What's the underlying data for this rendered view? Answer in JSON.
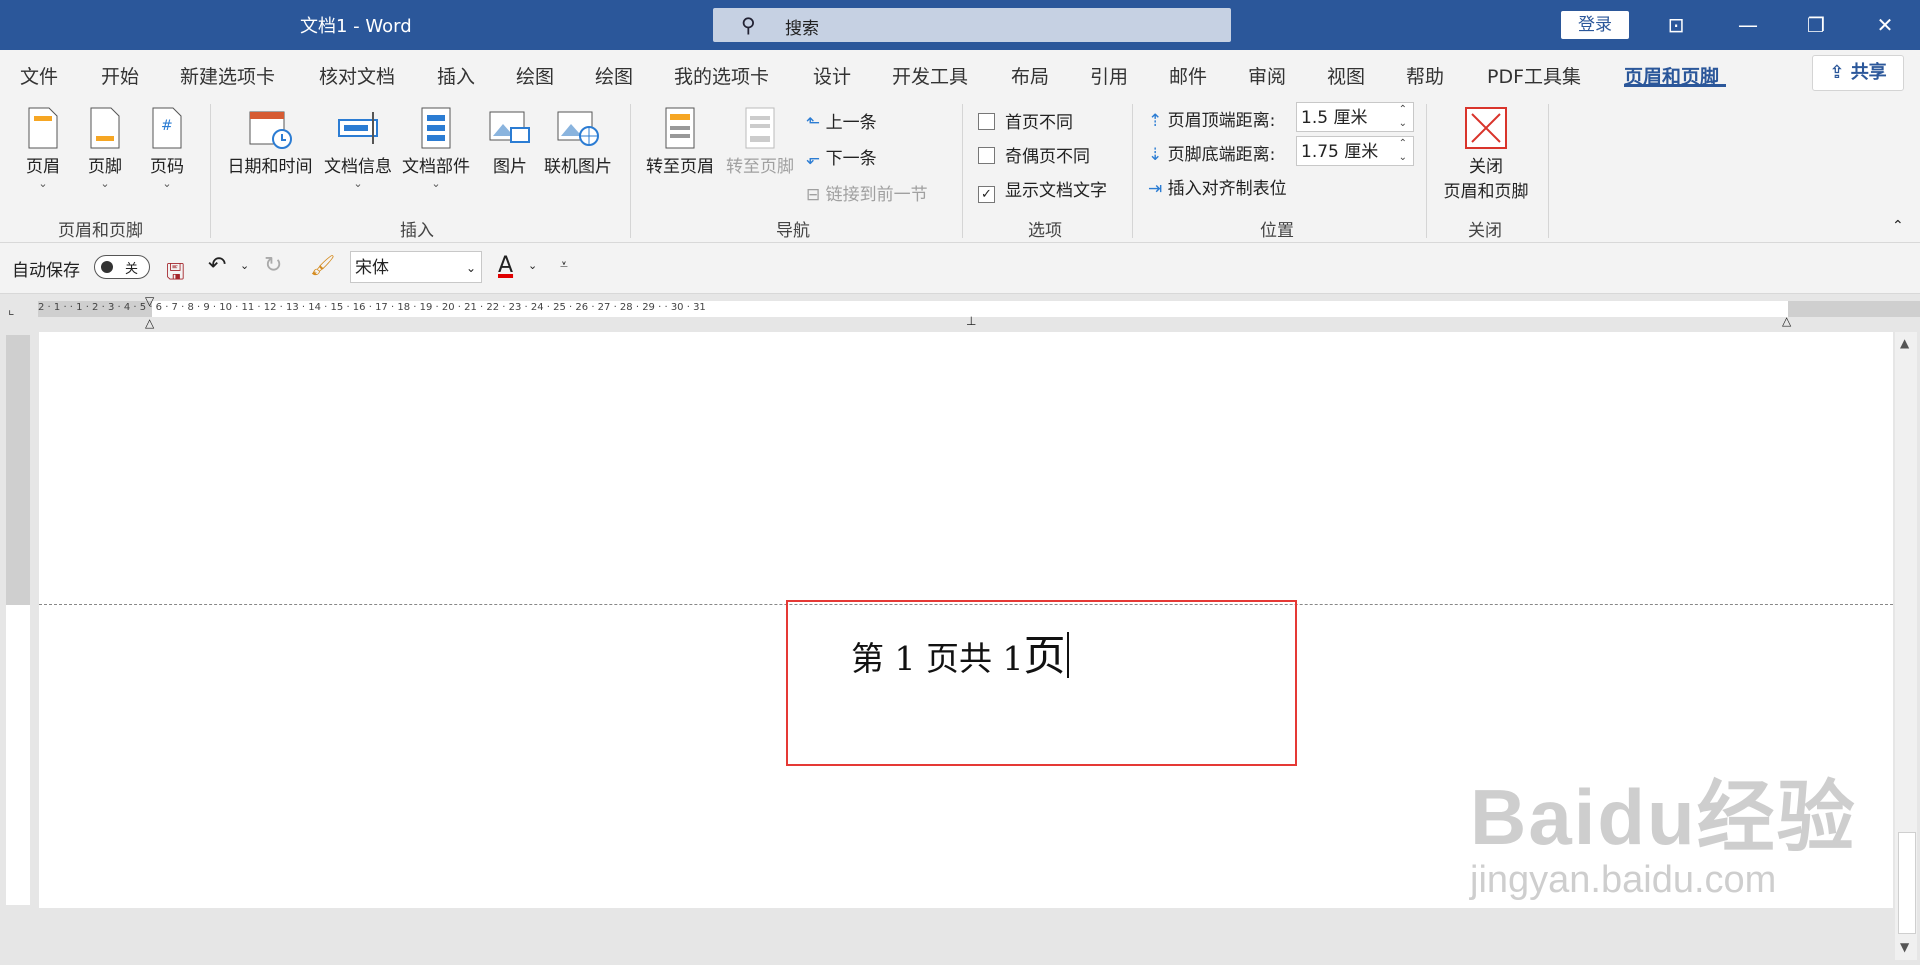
{
  "app": {
    "title": "文档1 - Word",
    "search_placeholder": "搜索",
    "login": "登录"
  },
  "menu": {
    "tabs": [
      "文件",
      "开始",
      "新建选项卡",
      "核对文档",
      "插入",
      "绘图",
      "绘图",
      "我的选项卡",
      "设计",
      "开发工具",
      "布局",
      "引用",
      "邮件",
      "审阅",
      "视图",
      "帮助",
      "PDF工具集",
      "页眉和页脚"
    ],
    "active_tab": "页眉和页脚",
    "share": "共享"
  },
  "ribbon": {
    "group1": {
      "label": "页眉和页脚",
      "buttons": [
        "页眉",
        "页脚",
        "页码"
      ]
    },
    "group2": {
      "label": "插入",
      "buttons": [
        "日期和时间",
        "文档信息",
        "文档部件",
        "图片",
        "联机图片"
      ]
    },
    "group3": {
      "label": "导航",
      "goto_header": "转至页眉",
      "goto_footer": "转至页脚",
      "prev": "上一条",
      "next": "下一条",
      "link_prev": "链接到前一节"
    },
    "group4": {
      "label": "选项",
      "first_page_diff": "首页不同",
      "odd_even_diff": "奇偶页不同",
      "show_doc_text": "显示文档文字",
      "checked": [
        false,
        false,
        true
      ]
    },
    "group5": {
      "label": "位置",
      "header_top": "页眉顶端距离:",
      "header_top_value": "1.5 厘米",
      "footer_bottom": "页脚底端距离:",
      "footer_bottom_value": "1.75 厘米",
      "insert_align_tab": "插入对齐制表位"
    },
    "group6": {
      "label": "关闭",
      "close_line1": "关闭",
      "close_line2": "页眉和页脚"
    }
  },
  "qat": {
    "autosave": "自动保存",
    "autosave_state": "关",
    "font": "宋体",
    "font_color_letter": "A"
  },
  "ruler": {
    "numbers": "2 · 1 · · 1 · 2 · 3 · 4 · 5 · 6 · 7 · 8 · 9 · 10 · 11 · 12 · 13 · 14 · 15 · 16 · 17 · 18 · 19 · 20 · 21 · 22 · 23 · 24 · 25 · 26 · 27 · 28 · 29 · · 30 · 31"
  },
  "document": {
    "header_text": "第 1 页共 1",
    "header_last_char": "页"
  },
  "watermark": {
    "line1": "Baidu经验",
    "line2": "jingyan.baidu.com"
  },
  "colors": {
    "brand": "#2b579a",
    "highlight_box": "#e53935"
  }
}
